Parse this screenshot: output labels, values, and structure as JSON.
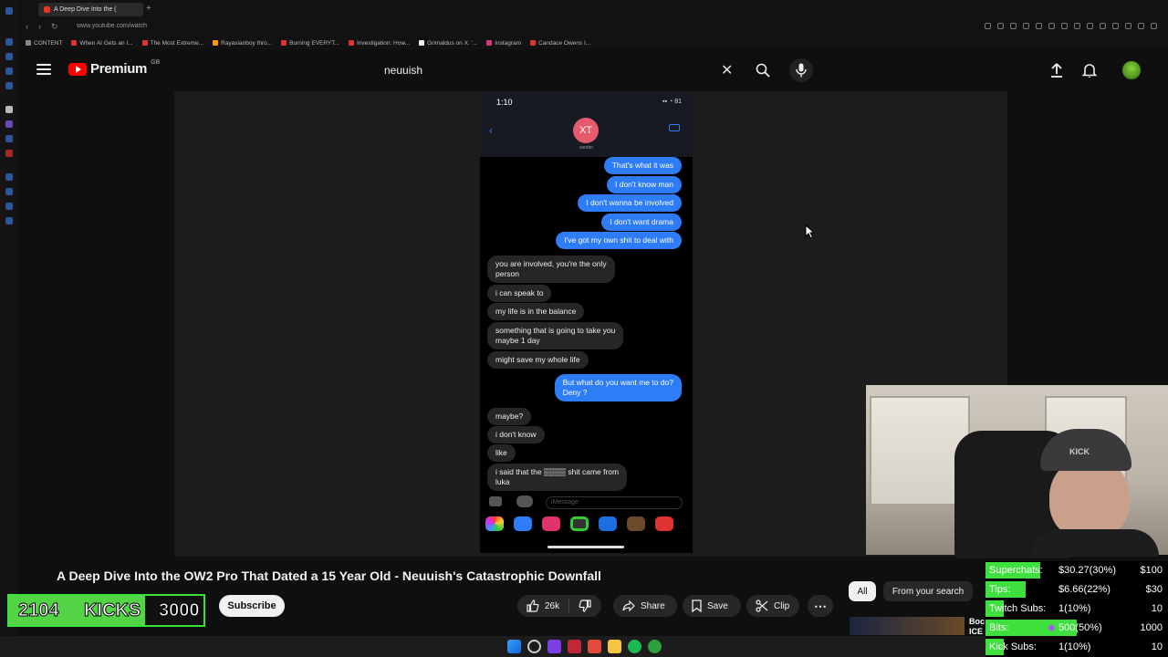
{
  "browser": {
    "tab_title": "A Deep Dive Into the (",
    "url": "www.youtube.com/watch",
    "bookmarks": [
      "CONTENT",
      "When AI Gets an I...",
      "The Most Extreme...",
      "Rayasianboy thro...",
      "Burning EVERYT...",
      "Investigation: How...",
      "Grimaldus on X: '...",
      "Instagram",
      "Candace Owens I..."
    ]
  },
  "header": {
    "logo_text": "Premium",
    "logo_region": "GB",
    "search_value": "neuuish"
  },
  "phone": {
    "time": "1:10",
    "status_icons": "▪▪ ◔ 81",
    "contact_initials": "XT",
    "contact_name": "xander",
    "input_placeholder": "iMessage",
    "messages": [
      {
        "dir": "out",
        "text": "That's what it was"
      },
      {
        "dir": "out",
        "text": "I don't know man"
      },
      {
        "dir": "out",
        "text": "I don't wanna be involved"
      },
      {
        "dir": "out",
        "text": "I don't want drama"
      },
      {
        "dir": "out",
        "text": "I've got my own shit to deal with"
      },
      {
        "dir": "in",
        "text": "you are involved, you're the only\nperson"
      },
      {
        "dir": "in",
        "text": "i can speak to"
      },
      {
        "dir": "in",
        "text": "my life is in the balance"
      },
      {
        "dir": "in",
        "text": "something that is going to take you\nmaybe 1 day"
      },
      {
        "dir": "in",
        "text": "might save my whole life"
      },
      {
        "dir": "out",
        "text": "But what do you want me to do?\nDeny ?"
      },
      {
        "dir": "in",
        "text": "maybe?"
      },
      {
        "dir": "in",
        "text": "i don't know"
      },
      {
        "dir": "in",
        "text": "like"
      },
      {
        "dir": "in",
        "text": "i said that the ▒▒▒▒ shit came from\nluka"
      }
    ]
  },
  "webcam": {
    "cap_text": "KICK"
  },
  "video": {
    "title": "A Deep Dive Into the OW2 Pro That Dated a 15 Year Old - Neuuish's Catastrophic Downfall",
    "subscribe_label": "Subscribe",
    "like_count": "26k",
    "share_label": "Share",
    "save_label": "Save",
    "clip_label": "Clip"
  },
  "kicks": {
    "current": "2104",
    "label": "KICKS",
    "goal": "3000",
    "progress": 0.7
  },
  "filters": {
    "all_label": "All",
    "search_label": "From your search"
  },
  "related_thumb_text": "Boc\nICE",
  "stats": [
    {
      "label": "Superchats:",
      "value": "$30.27(30%)",
      "goal": "$100",
      "fraction": 0.3
    },
    {
      "label": "Tips:",
      "value": "$6.66(22%)",
      "goal": "$30",
      "fraction": 0.22
    },
    {
      "label": "Twitch Subs:",
      "value": "1(10%)",
      "goal": "10",
      "fraction": 0.1
    },
    {
      "label": "Bits:",
      "value": "500(50%)",
      "goal": "1000",
      "fraction": 0.5
    },
    {
      "label": "Kick Subs:",
      "value": "1(10%)",
      "goal": "10",
      "fraction": 0.1
    }
  ],
  "colors": {
    "accent_red": "#ff0000",
    "imessage_blue": "#2e7cf6",
    "kick_green": "#53d447",
    "stat_green": "#3de03d"
  }
}
